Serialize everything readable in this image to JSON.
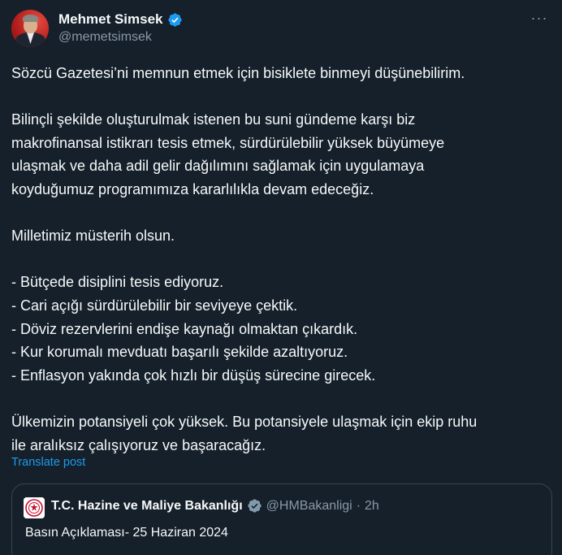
{
  "author": {
    "display_name": "Mehmet Simsek",
    "handle": "@memetsimsek"
  },
  "menu": {
    "more_label": "···"
  },
  "tweet": {
    "paragraph_1": "Sözcü Gazetesi’ni memnun etmek için bisiklete binmeyi düşünebilirim.",
    "paragraph_2": "Bilinçli şekilde oluşturulmak istenen bu suni gündeme karşı biz\nmakrofinansal istikrarı tesis etmek, sürdürülebilir yüksek büyümeye\nulaşmak ve daha adil gelir dağılımını sağlamak için uygulamaya\nkoyduğumuz programımıza kararlılıkla devam edeceğiz.",
    "paragraph_3": "Milletimiz müsterih olsun.",
    "bullets": [
      "- Bütçede disiplini tesis ediyoruz.",
      "- Cari açığı sürdürülebilir bir seviyeye çektik.",
      "- Döviz rezervlerini endişe kaynağı olmaktan çıkardık.",
      "- Kur korumalı mevduatı başarılı şekilde azaltıyoruz.",
      "- Enflasyon yakında çok hızlı bir düşüş sürecine girecek."
    ],
    "paragraph_4": "Ülkemizin potansiyeli çok yüksek. Bu potansiyele ulaşmak için ekip ruhu\nile aralıksız çalışıyoruz ve başaracağız.",
    "translate_label": "Translate post"
  },
  "quoted": {
    "display_name": "T.C. Hazine ve Maliye Bakanlığı",
    "handle": "@HMBakanligi",
    "separator": "·",
    "time": "2h",
    "text": "Basın Açıklaması- 25 Haziran 2024"
  },
  "colors": {
    "background": "#15202b",
    "text": "#f7f9f9",
    "secondary": "#8b98a5",
    "link": "#1d9bf0",
    "verified_blue": "#1d9bf0",
    "verified_gray": "#829aab",
    "border": "#38444d"
  },
  "icons": {
    "author_verified": "verified-badge-icon",
    "quoted_verified": "verified-badge-gray-icon",
    "more": "more-icon",
    "org_logo": "ministry-logo-icon"
  }
}
